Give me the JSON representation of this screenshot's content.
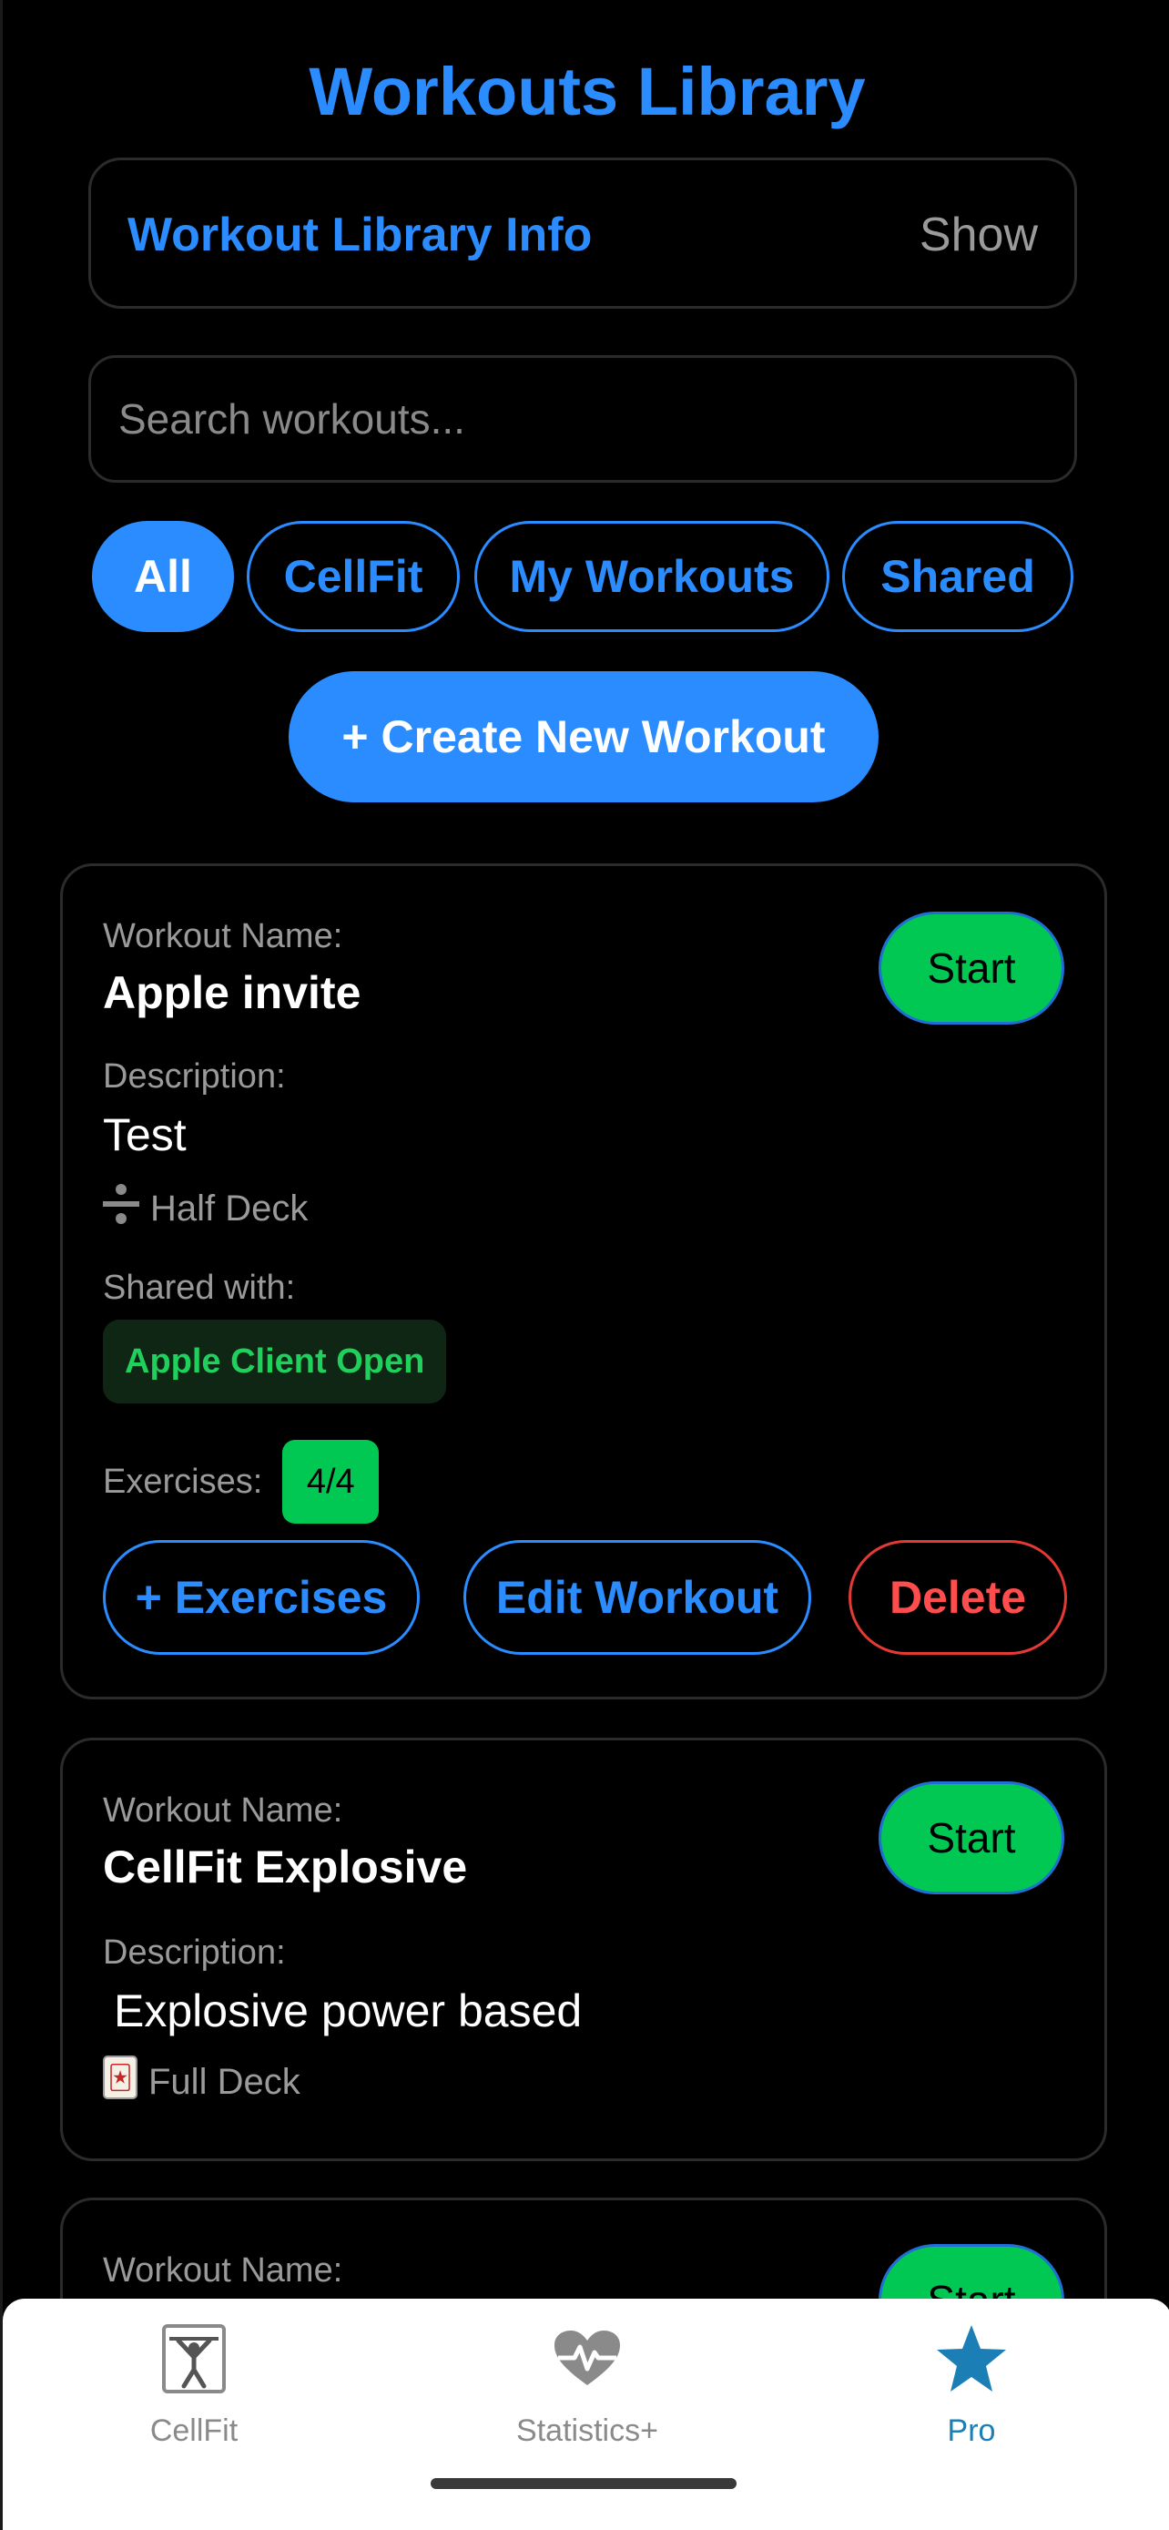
{
  "header": {
    "title": "Workouts Library"
  },
  "info": {
    "title": "Workout Library Info",
    "toggle": "Show"
  },
  "search": {
    "placeholder": "Search workouts..."
  },
  "filters": [
    "All",
    "CellFit",
    "My Workouts",
    "Shared"
  ],
  "create_button": "+ Create New Workout",
  "labels": {
    "workout_name": "Workout Name:",
    "description": "Description:",
    "shared_with": "Shared with:",
    "exercises": "Exercises:",
    "start": "Start"
  },
  "workouts": [
    {
      "name": "Apple invite",
      "description": "Test",
      "deck": "Half Deck",
      "shared_with": "Apple Client Open",
      "exercises": "4/4",
      "actions": {
        "add": "+ Exercises",
        "edit": "Edit Workout",
        "delete": "Delete"
      }
    },
    {
      "name": "CellFit Explosive",
      "description": "Explosive power based",
      "deck": "Full Deck"
    },
    {}
  ],
  "tabs": [
    {
      "label": "CellFit",
      "icon": "weightlifter-icon"
    },
    {
      "label": "Statistics+",
      "icon": "heart-pulse-icon"
    },
    {
      "label": "Pro",
      "icon": "star-icon"
    }
  ],
  "colors": {
    "accent": "#2a8cff",
    "start": "#00c853",
    "delete": "#e53935",
    "pro_tab": "#1b7fb6"
  }
}
